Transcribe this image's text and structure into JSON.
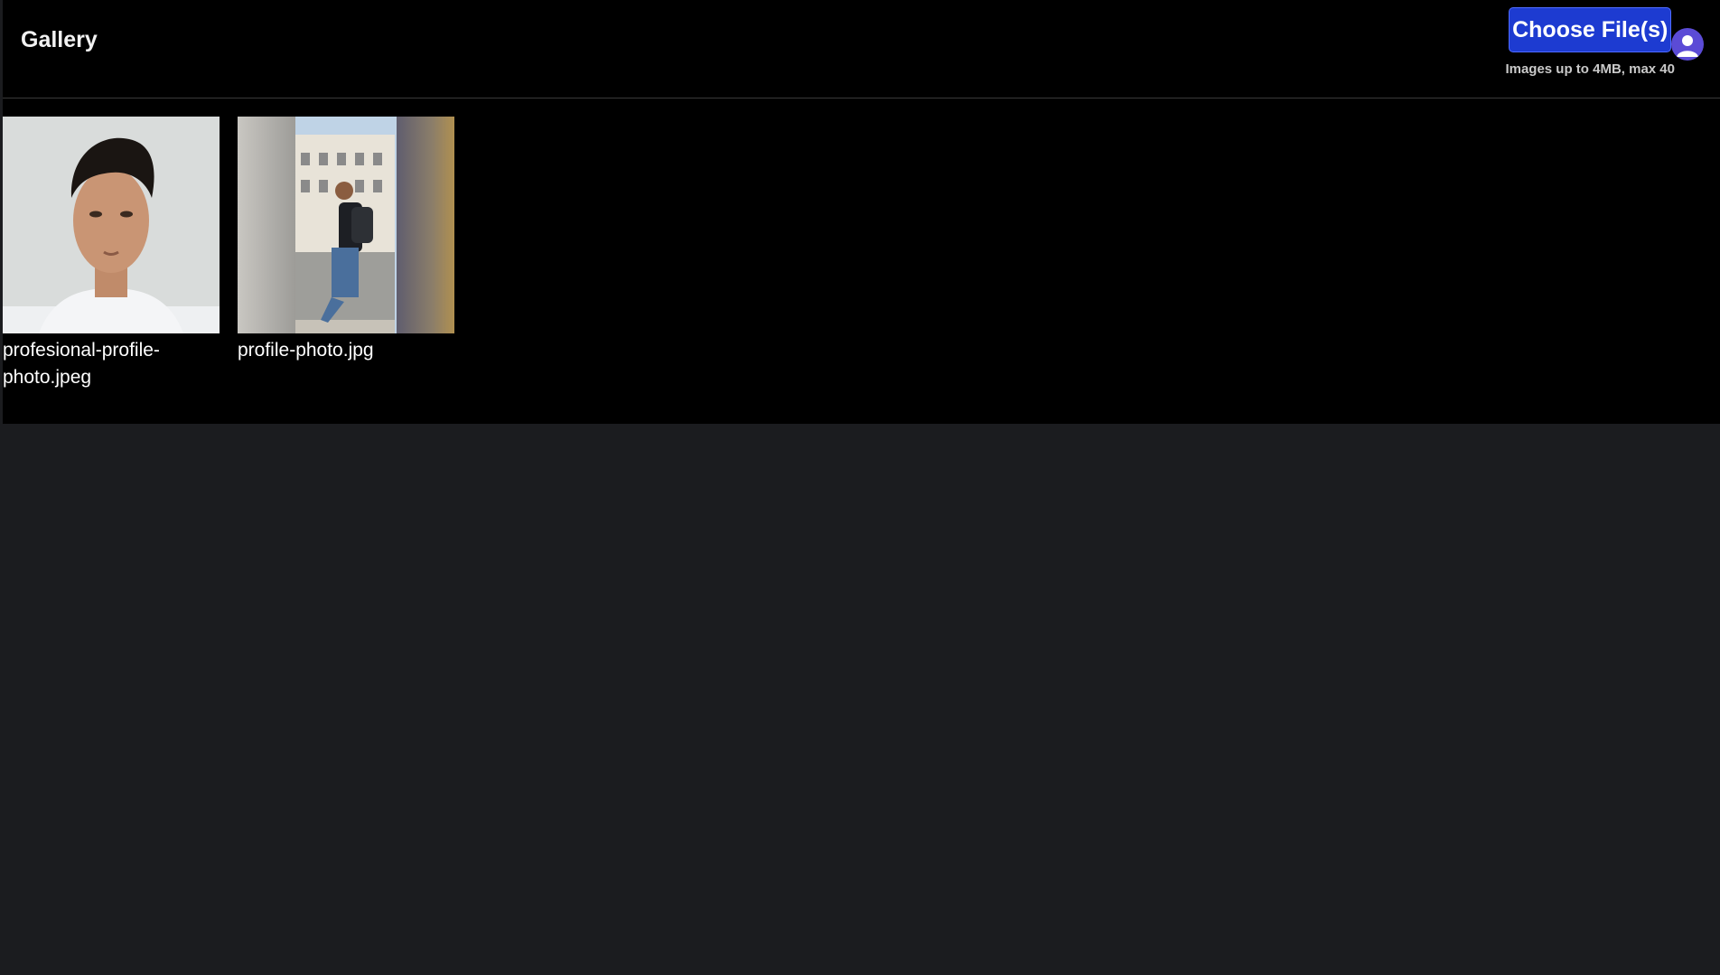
{
  "header": {
    "title": "Gallery",
    "upload_button_label": "Choose File(s)",
    "upload_hint": "Images up to 4MB, max 40"
  },
  "gallery": {
    "items": [
      {
        "filename": "profesional-profile-photo.jpeg"
      },
      {
        "filename": "profile-photo.jpg"
      }
    ]
  },
  "colors": {
    "accent": "#1d3bd1",
    "avatar": "#5b4bd6",
    "page_background": "#1b1c1f",
    "panel_background": "#000000"
  }
}
